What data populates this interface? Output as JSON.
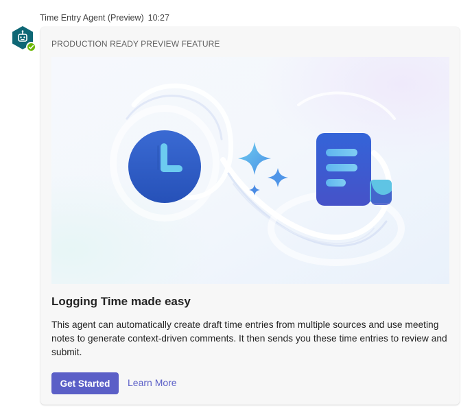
{
  "message": {
    "sender": "Time Entry Agent (Preview)",
    "time": "10:27",
    "avatar_icon": "bot-hexagon-icon",
    "presence": "available"
  },
  "card": {
    "preview_label": "PRODUCTION READY PREVIEW FEATURE",
    "hero_icons": [
      "clock-icon",
      "sparkle-icon",
      "document-icon"
    ],
    "title": "Logging Time made easy",
    "body": "This agent can automatically create draft time entries from multiple sources and use meeting notes to generate context-driven comments. It then sends you these time entries to review and submit.",
    "primary_button": "Get Started",
    "secondary_link": "Learn More"
  },
  "colors": {
    "accent": "#5b5fc7",
    "avatar": "#0e6775",
    "presence": "#6bb700",
    "clock": "#2f5fc9",
    "document": "#3e5fd6",
    "sparkle": "#55b9e8"
  }
}
